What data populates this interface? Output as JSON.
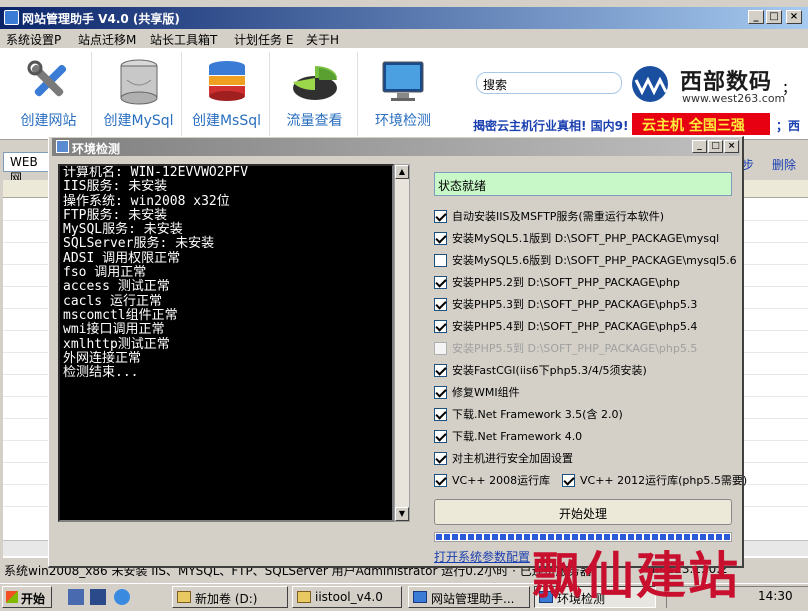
{
  "main_window": {
    "title": "网站管理助手 V4.0 (共享版)",
    "caption_buttons": [
      "_",
      "□",
      "×"
    ]
  },
  "menu": [
    "系统设置P",
    "站点迁移M",
    "站长工具箱T",
    "计划任务 E",
    "关于H"
  ],
  "toolbar": [
    {
      "label": "创建网站",
      "icon": "tools-icon"
    },
    {
      "label": "创建MySql",
      "icon": "database-icon"
    },
    {
      "label": "创建MsSql",
      "icon": "database-stack-icon"
    },
    {
      "label": "流量查看",
      "icon": "pie-chart-icon"
    },
    {
      "label": "环境检测",
      "icon": "monitor-icon"
    }
  ],
  "search": {
    "placeholder": "搜索"
  },
  "brand": {
    "name": "西部数码",
    "url": "www.west263.com",
    "sep": "；"
  },
  "ads": {
    "ad1": "揭密云主机行业真相! 国内9!",
    "ad2": "云主机 全国三强",
    "ad3": "；西"
  },
  "underbar": {
    "web_tab": "WEB网",
    "step": "步",
    "delete": "删除"
  },
  "status_bar": {
    "text": "系统win2008_x86 未安装 IIS、MYSQL、FTP、SQLServer 用户Administrator 运行0.2小时 · 已连接服务器",
    "right": "IP 123.150.2"
  },
  "dialog": {
    "title": "环境检测",
    "caption_buttons": [
      "_",
      "□",
      "×"
    ],
    "console_lines": [
      "计算机名: WIN-12EVVWO2PFV",
      "IIS服务: 未安装",
      "操作系统: win2008 x32位",
      "FTP服务: 未安装",
      "MySQL服务: 未安装",
      "SQLServer服务: 未安装",
      "ADSI 调用权限正常",
      "fso 调用正常",
      "access 测试正常",
      "cacls 运行正常",
      "mscomctl组件正常",
      "wmi接口调用正常",
      "xmlhttp测试正常",
      "外网连接正常",
      "检测结束..."
    ],
    "status_value": "状态就绪",
    "options": [
      {
        "label": "自动安装IIS及MSFTP服务(需重运行本软件)",
        "checked": true,
        "disabled": false
      },
      {
        "label": "安装MySQL5.1版到 D:\\SOFT_PHP_PACKAGE\\mysql",
        "checked": true,
        "disabled": false
      },
      {
        "label": "安装MySQL5.6版到 D:\\SOFT_PHP_PACKAGE\\mysql5.6",
        "checked": false,
        "disabled": false
      },
      {
        "label": "安装PHP5.2到 D:\\SOFT_PHP_PACKAGE\\php",
        "checked": true,
        "disabled": false
      },
      {
        "label": "安装PHP5.3到 D:\\SOFT_PHP_PACKAGE\\php5.3",
        "checked": true,
        "disabled": false
      },
      {
        "label": "安装PHP5.4到 D:\\SOFT_PHP_PACKAGE\\php5.4",
        "checked": true,
        "disabled": false
      },
      {
        "label": "安装PHP5.5到 D:\\SOFT_PHP_PACKAGE\\php5.5",
        "checked": false,
        "disabled": true
      },
      {
        "label": "安装FastCGI(iis6下php5.3/4/5须安装)",
        "checked": true,
        "disabled": false
      },
      {
        "label": "修复WMI组件",
        "checked": true,
        "disabled": false
      },
      {
        "label": "下载.Net Framework 3.5(含 2.0)",
        "checked": true,
        "disabled": false
      },
      {
        "label": "下载.Net Framework 4.0",
        "checked": true,
        "disabled": false
      },
      {
        "label": "对主机进行安全加固设置",
        "checked": true,
        "disabled": false
      }
    ],
    "vc_options": [
      {
        "label": "VC++ 2008运行库",
        "checked": true
      },
      {
        "label": "VC++ 2012运行库(php5.5需要)",
        "checked": true
      }
    ],
    "start_button": "开始处理",
    "progress": 1.0,
    "open_config_link": "打开系统参数配置"
  },
  "taskbar": {
    "start": "开始",
    "tasks": [
      {
        "label": "新加卷 (D:)",
        "active": false
      },
      {
        "label": "iistool_v4.0",
        "active": false
      },
      {
        "label": "网站管理助手...",
        "active": false
      },
      {
        "label": "环境检测",
        "active": true
      }
    ],
    "clock": "14:30"
  },
  "watermark": "飘仙建站",
  "colors": {
    "title_active": "#0a246a",
    "title_inactive": "#808080",
    "link": "#1a3fb0",
    "ad_red": "#e60012",
    "status_green": "#c8f8c8",
    "watermark": "#c8102e"
  }
}
